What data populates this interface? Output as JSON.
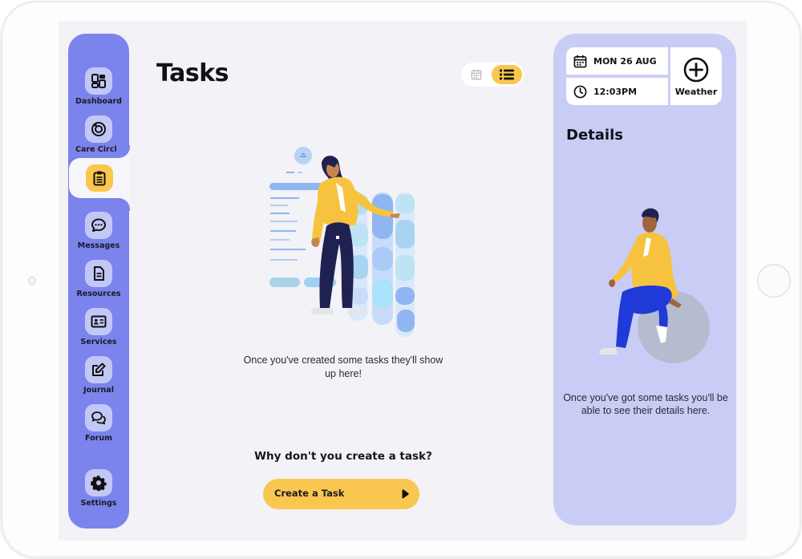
{
  "sidebar": {
    "items": [
      {
        "label": "Dashboard",
        "icon": "dashboard-icon"
      },
      {
        "label": "Care Circle",
        "icon": "care-circle-icon"
      },
      {
        "label": "",
        "icon": "clipboard-icon",
        "active": true
      },
      {
        "label": "Messages",
        "icon": "chat-icon"
      },
      {
        "label": "Resources",
        "icon": "document-icon"
      },
      {
        "label": "Services",
        "icon": "id-card-icon"
      },
      {
        "label": "Journal",
        "icon": "edit-icon"
      },
      {
        "label": "Forum",
        "icon": "forum-icon"
      },
      {
        "label": "Settings",
        "icon": "gear-icon"
      }
    ]
  },
  "main": {
    "title": "Tasks",
    "view_toggle": {
      "options": [
        "calendar-icon",
        "list-icon"
      ],
      "selected": "list"
    },
    "empty_message": "Once you've created some tasks they'll show up here!",
    "prompt": "Why don't you create a task?",
    "create_button_label": "Create a Task"
  },
  "details": {
    "date": "MON 26 AUG",
    "time": "12:03PM",
    "weather_label": "Weather",
    "title": "Details",
    "empty_message": "Once you've got some tasks you'll be able to see their details here."
  },
  "colors": {
    "sidebar": "#7b84ec",
    "accent": "#f9c74f",
    "panel": "#c9cdf6",
    "background": "#f2f2f7"
  }
}
